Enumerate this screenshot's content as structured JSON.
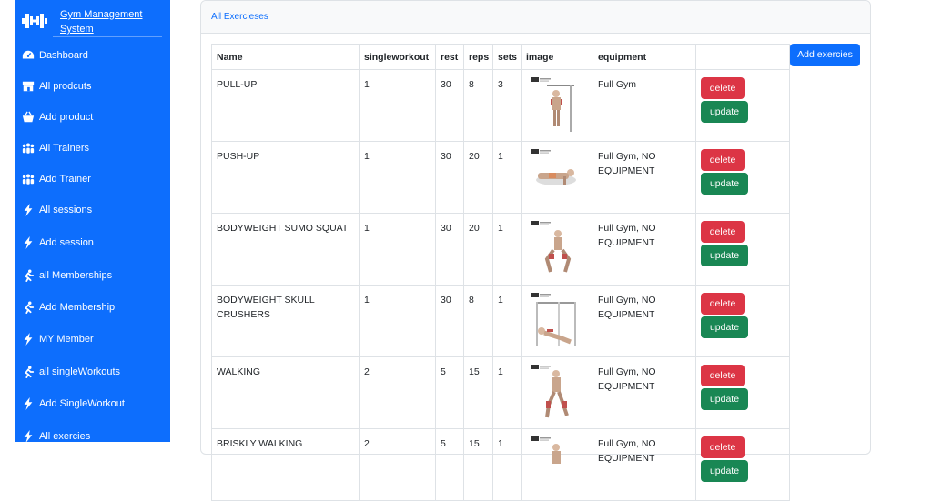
{
  "app": {
    "title": "Gym Management System",
    "title_line1": "Gym Management",
    "title_line2": "System"
  },
  "sidebar": {
    "items": [
      {
        "label": "Dashboard",
        "icon": "speedometer-icon"
      },
      {
        "label": "All prodcuts",
        "icon": "shop-icon"
      },
      {
        "label": "Add product",
        "icon": "basket-icon"
      },
      {
        "label": "All Trainers",
        "icon": "people-icon"
      },
      {
        "label": "Add Trainer",
        "icon": "people-icon"
      },
      {
        "label": "All sessions",
        "icon": "lightning-icon"
      },
      {
        "label": "Add session",
        "icon": "lightning-icon"
      },
      {
        "label": "all Memberships",
        "icon": "running-person-icon"
      },
      {
        "label": "Add Membership",
        "icon": "running-person-icon"
      },
      {
        "label": "MY Member",
        "icon": "lightning-icon"
      },
      {
        "label": "all singleWorkouts",
        "icon": "running-person-icon"
      },
      {
        "label": "Add SingleWorkout",
        "icon": "lightning-icon"
      },
      {
        "label": "All exercies",
        "icon": "lightning-icon"
      }
    ]
  },
  "main": {
    "header": "All Exercieses",
    "add_button": "Add exercies",
    "columns": [
      "Name",
      "singleworkout",
      "rest",
      "reps",
      "sets",
      "image",
      "equipment",
      ""
    ],
    "rows": [
      {
        "name": "PULL-UP",
        "singleworkout": "1",
        "rest": "30",
        "reps": "8",
        "sets": "3",
        "image": "pull-up-illustration",
        "equipment": "Full Gym"
      },
      {
        "name": "PUSH-UP",
        "singleworkout": "1",
        "rest": "30",
        "reps": "20",
        "sets": "1",
        "image": "push-up-illustration",
        "equipment": "Full Gym, NO EQUIPMENT"
      },
      {
        "name": "BODYWEIGHT SUMO SQUAT",
        "singleworkout": "1",
        "rest": "30",
        "reps": "20",
        "sets": "1",
        "image": "sumo-squat-illustration",
        "equipment": "Full Gym, NO EQUIPMENT"
      },
      {
        "name": "BODYWEIGHT SKULL CRUSHERS",
        "singleworkout": "1",
        "rest": "30",
        "reps": "8",
        "sets": "1",
        "image": "skull-crusher-illustration",
        "equipment": "Full Gym, NO EQUIPMENT"
      },
      {
        "name": "WALKING",
        "singleworkout": "2",
        "rest": "5",
        "reps": "15",
        "sets": "1",
        "image": "walking-illustration",
        "equipment": "Full Gym, NO EQUIPMENT"
      },
      {
        "name": "BRISKLY WALKING",
        "singleworkout": "2",
        "rest": "5",
        "reps": "15",
        "sets": "1",
        "image": "brisk-walking-illustration",
        "equipment": "Full Gym, NO EQUIPMENT"
      }
    ],
    "delete_label": "delete",
    "update_label": "update"
  },
  "colors": {
    "primary": "#0d6efd",
    "danger": "#dc3545",
    "success": "#198754"
  }
}
